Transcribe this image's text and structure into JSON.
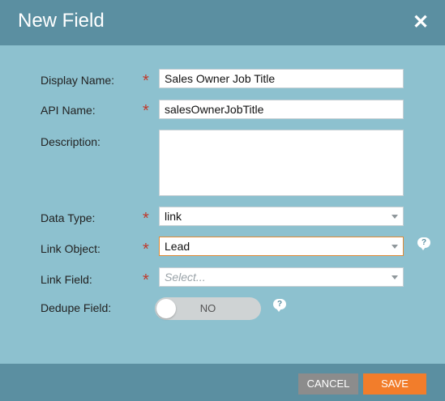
{
  "dialog": {
    "title": "New Field",
    "close_icon": "close-icon"
  },
  "fields": {
    "display_name": {
      "label": "Display Name:",
      "value": "Sales Owner Job Title"
    },
    "api_name": {
      "label": "API Name:",
      "value": "salesOwnerJobTitle"
    },
    "description": {
      "label": "Description:",
      "value": ""
    },
    "data_type": {
      "label": "Data Type:",
      "value": "link"
    },
    "link_object": {
      "label": "Link Object:",
      "value": "Lead"
    },
    "link_field": {
      "label": "Link Field:",
      "placeholder": "Select..."
    },
    "dedupe_field": {
      "label": "Dedupe Field:",
      "toggle_text": "NO"
    }
  },
  "required_marker": "*",
  "help_glyph": "?",
  "footer": {
    "cancel_label": "CANCEL",
    "save_label": "SAVE"
  },
  "colors": {
    "header": "#5b8fa1",
    "body": "#8dc1cf",
    "save": "#f27d2b",
    "cancel": "#8c8c8c",
    "required": "#c0392b"
  }
}
